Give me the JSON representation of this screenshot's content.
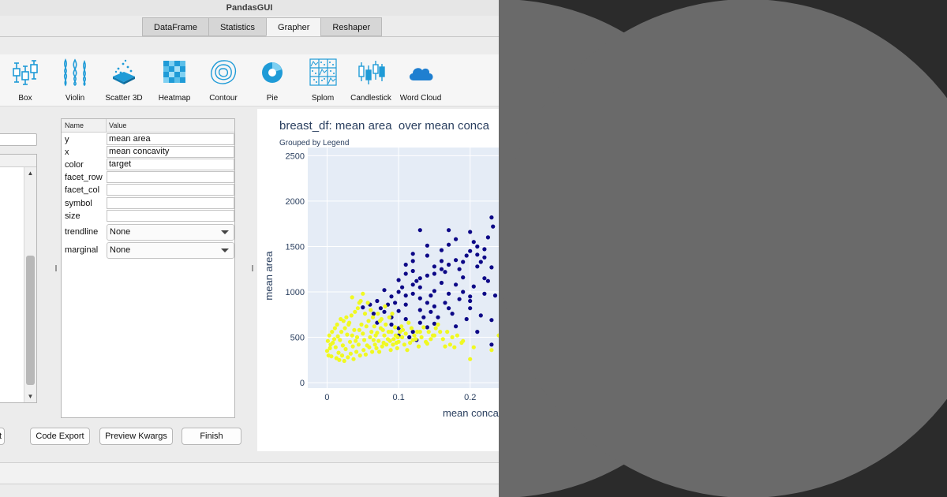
{
  "window": {
    "title": "PandasGUI"
  },
  "tabs": [
    {
      "label": "DataFrame",
      "active": false
    },
    {
      "label": "Statistics",
      "active": false
    },
    {
      "label": "Grapher",
      "active": true
    },
    {
      "label": "Reshaper",
      "active": false
    }
  ],
  "plot_types": [
    {
      "label": "Box",
      "icon": "box-plot-icon"
    },
    {
      "label": "Violin",
      "icon": "violin-plot-icon"
    },
    {
      "label": "Scatter 3D",
      "icon": "scatter-3d-icon"
    },
    {
      "label": "Heatmap",
      "icon": "heatmap-icon"
    },
    {
      "label": "Contour",
      "icon": "contour-icon"
    },
    {
      "label": "Pie",
      "icon": "pie-chart-icon"
    },
    {
      "label": "Splom",
      "icon": "splom-icon"
    },
    {
      "label": "Candlestick",
      "icon": "candlestick-icon"
    },
    {
      "label": "Word Cloud",
      "icon": "word-cloud-icon"
    }
  ],
  "kwargs": {
    "header": {
      "name": "Name",
      "value": "Value"
    },
    "fields": [
      {
        "name": "y",
        "value": "mean area"
      },
      {
        "name": "x",
        "value": "mean concavity"
      },
      {
        "name": "color",
        "value": "target"
      },
      {
        "name": "facet_row",
        "value": ""
      },
      {
        "name": "facet_col",
        "value": ""
      },
      {
        "name": "symbol",
        "value": ""
      },
      {
        "name": "size",
        "value": ""
      }
    ],
    "dropdowns": [
      {
        "name": "trendline",
        "value": "None"
      },
      {
        "name": "marginal",
        "value": "None"
      }
    ]
  },
  "buttons": {
    "reset": "t",
    "code_export": "Code Export",
    "preview_kwargs": "Preview Kwargs",
    "finish": "Finish"
  },
  "colors": {
    "accent_icon": "#1f9bd7",
    "plot_bg": "#e5ecf6",
    "series_target_0": "#0d0887",
    "series_target_1": "#f0f921"
  },
  "chart_data": {
    "type": "scatter",
    "title": "breast_df: mean area  over mean conca",
    "subtitle": "Grouped by Legend",
    "xlabel": "mean conca",
    "ylabel": "mean area",
    "xlim": [
      -0.027,
      0.24
    ],
    "ylim": [
      -60,
      2590
    ],
    "xticks": [
      "0",
      "0.1",
      "0.2"
    ],
    "yticks": [
      "0",
      "500",
      "1000",
      "1500",
      "2000",
      "2500"
    ],
    "grid": true,
    "series": [
      {
        "points": [
          [
            0.09,
            950
          ],
          [
            0.1,
            1000
          ],
          [
            0.12,
            1080
          ],
          [
            0.13,
            1150
          ],
          [
            0.15,
            1200
          ],
          [
            0.16,
            1250
          ],
          [
            0.17,
            1300
          ],
          [
            0.18,
            1350
          ],
          [
            0.2,
            1450
          ],
          [
            0.21,
            1500
          ],
          [
            0.22,
            1150
          ],
          [
            0.2,
            900
          ],
          [
            0.19,
            1000
          ],
          [
            0.14,
            880
          ],
          [
            0.11,
            1300
          ],
          [
            0.12,
            1420
          ],
          [
            0.13,
            1680
          ],
          [
            0.17,
            1680
          ],
          [
            0.2,
            1660
          ],
          [
            0.23,
            1820
          ],
          [
            0.232,
            1720
          ],
          [
            0.1,
            790
          ],
          [
            0.08,
            780
          ],
          [
            0.09,
            720
          ],
          [
            0.11,
            700
          ],
          [
            0.13,
            660
          ],
          [
            0.15,
            650
          ],
          [
            0.17,
            820
          ],
          [
            0.2,
            820
          ],
          [
            0.23,
            690
          ],
          [
            0.07,
            900
          ],
          [
            0.06,
            860
          ],
          [
            0.05,
            830
          ],
          [
            0.12,
            1230
          ],
          [
            0.14,
            1400
          ],
          [
            0.16,
            1460
          ],
          [
            0.19,
            1160
          ],
          [
            0.21,
            1280
          ],
          [
            0.22,
            1380
          ],
          [
            0.18,
            1080
          ],
          [
            0.15,
            1010
          ],
          [
            0.13,
            930
          ],
          [
            0.11,
            860
          ],
          [
            0.12,
            560
          ],
          [
            0.14,
            610
          ],
          [
            0.09,
            640
          ],
          [
            0.1,
            600
          ],
          [
            0.18,
            620
          ],
          [
            0.21,
            560
          ],
          [
            0.23,
            420
          ],
          [
            0.2,
            950
          ],
          [
            0.22,
            980
          ],
          [
            0.16,
            1100
          ],
          [
            0.14,
            1180
          ],
          [
            0.12,
            980
          ],
          [
            0.1,
            1130
          ],
          [
            0.08,
            1020
          ],
          [
            0.11,
            1200
          ],
          [
            0.13,
            1050
          ],
          [
            0.17,
            980
          ],
          [
            0.19,
            1330
          ],
          [
            0.16,
            1340
          ],
          [
            0.15,
            1280
          ],
          [
            0.21,
            1410
          ],
          [
            0.22,
            1470
          ],
          [
            0.23,
            1270
          ],
          [
            0.17,
            1520
          ],
          [
            0.18,
            1580
          ],
          [
            0.14,
            1510
          ],
          [
            0.12,
            1340
          ],
          [
            0.105,
            1050
          ],
          [
            0.125,
            1120
          ],
          [
            0.145,
            960
          ],
          [
            0.165,
            880
          ],
          [
            0.185,
            920
          ],
          [
            0.205,
            1060
          ],
          [
            0.225,
            1120
          ],
          [
            0.235,
            960
          ],
          [
            0.095,
            880
          ],
          [
            0.085,
            860
          ],
          [
            0.075,
            820
          ],
          [
            0.065,
            760
          ],
          [
            0.155,
            720
          ],
          [
            0.175,
            760
          ],
          [
            0.195,
            700
          ],
          [
            0.215,
            740
          ],
          [
            0.1,
            520
          ],
          [
            0.115,
            500
          ],
          [
            0.125,
            470
          ],
          [
            0.135,
            720
          ],
          [
            0.145,
            780
          ],
          [
            0.165,
            1220
          ],
          [
            0.185,
            1250
          ],
          [
            0.195,
            1400
          ],
          [
            0.205,
            1550
          ],
          [
            0.215,
            1330
          ],
          [
            0.225,
            1600
          ],
          [
            0.11,
            960
          ],
          [
            0.13,
            800
          ],
          [
            0.15,
            840
          ],
          [
            0.07,
            660
          ]
        ]
      },
      {
        "points": [
          [
            0.0,
            350
          ],
          [
            0.005,
            420
          ],
          [
            0.01,
            480
          ],
          [
            0.015,
            510
          ],
          [
            0.02,
            560
          ],
          [
            0.025,
            600
          ],
          [
            0.03,
            640
          ],
          [
            0.035,
            520
          ],
          [
            0.04,
            460
          ],
          [
            0.045,
            580
          ],
          [
            0.05,
            540
          ],
          [
            0.055,
            620
          ],
          [
            0.06,
            500
          ],
          [
            0.065,
            470
          ],
          [
            0.07,
            550
          ],
          [
            0.075,
            600
          ],
          [
            0.08,
            520
          ],
          [
            0.085,
            480
          ],
          [
            0.09,
            560
          ],
          [
            0.095,
            610
          ],
          [
            0.1,
            450
          ],
          [
            0.105,
            500
          ],
          [
            0.11,
            540
          ],
          [
            0.12,
            470
          ],
          [
            0.13,
            560
          ],
          [
            0.14,
            430
          ],
          [
            0.15,
            520
          ],
          [
            0.002,
            300
          ],
          [
            0.004,
            380
          ],
          [
            0.008,
            440
          ],
          [
            0.012,
            390
          ],
          [
            0.016,
            330
          ],
          [
            0.018,
            470
          ],
          [
            0.022,
            410
          ],
          [
            0.026,
            370
          ],
          [
            0.028,
            530
          ],
          [
            0.032,
            450
          ],
          [
            0.036,
            400
          ],
          [
            0.038,
            580
          ],
          [
            0.042,
            500
          ],
          [
            0.044,
            420
          ],
          [
            0.048,
            640
          ],
          [
            0.052,
            470
          ],
          [
            0.056,
            410
          ],
          [
            0.058,
            680
          ],
          [
            0.062,
            560
          ],
          [
            0.066,
            620
          ],
          [
            0.068,
            520
          ],
          [
            0.072,
            460
          ],
          [
            0.076,
            700
          ],
          [
            0.078,
            580
          ],
          [
            0.082,
            640
          ],
          [
            0.086,
            560
          ],
          [
            0.088,
            460
          ],
          [
            0.092,
            420
          ],
          [
            0.096,
            520
          ],
          [
            0.098,
            380
          ],
          [
            0.102,
            560
          ],
          [
            0.108,
            420
          ],
          [
            0.112,
            360
          ],
          [
            0.118,
            600
          ],
          [
            0.122,
            520
          ],
          [
            0.128,
            400
          ],
          [
            0.135,
            610
          ],
          [
            0.145,
            480
          ],
          [
            0.155,
            640
          ],
          [
            0.165,
            400
          ],
          [
            0.175,
            500
          ],
          [
            0.19,
            460
          ],
          [
            0.2,
            260
          ],
          [
            0.205,
            390
          ],
          [
            0.23,
            360
          ],
          [
            0.24,
            520
          ],
          [
            0.003,
            520
          ],
          [
            0.007,
            560
          ],
          [
            0.011,
            600
          ],
          [
            0.014,
            640
          ],
          [
            0.019,
            700
          ],
          [
            0.023,
            680
          ],
          [
            0.027,
            720
          ],
          [
            0.031,
            660
          ],
          [
            0.034,
            740
          ],
          [
            0.039,
            780
          ],
          [
            0.043,
            820
          ],
          [
            0.047,
            900
          ],
          [
            0.053,
            760
          ],
          [
            0.057,
            880
          ],
          [
            0.061,
            800
          ],
          [
            0.064,
            720
          ],
          [
            0.071,
            760
          ],
          [
            0.074,
            680
          ],
          [
            0.081,
            840
          ],
          [
            0.087,
            720
          ],
          [
            0.091,
            760
          ],
          [
            0.001,
            460
          ],
          [
            0.006,
            290
          ],
          [
            0.013,
            270
          ],
          [
            0.017,
            250
          ],
          [
            0.021,
            300
          ],
          [
            0.024,
            240
          ],
          [
            0.029,
            280
          ],
          [
            0.033,
            320
          ],
          [
            0.037,
            260
          ],
          [
            0.041,
            340
          ],
          [
            0.046,
            300
          ],
          [
            0.051,
            360
          ],
          [
            0.054,
            310
          ],
          [
            0.059,
            390
          ],
          [
            0.063,
            340
          ],
          [
            0.067,
            420
          ],
          [
            0.069,
            380
          ],
          [
            0.073,
            340
          ],
          [
            0.077,
            400
          ],
          [
            0.079,
            440
          ],
          [
            0.083,
            420
          ],
          [
            0.089,
            360
          ],
          [
            0.093,
            480
          ],
          [
            0.097,
            440
          ],
          [
            0.099,
            500
          ],
          [
            0.104,
            620
          ],
          [
            0.106,
            580
          ],
          [
            0.114,
            660
          ],
          [
            0.116,
            440
          ],
          [
            0.124,
            480
          ],
          [
            0.126,
            560
          ],
          [
            0.132,
            500
          ],
          [
            0.138,
            450
          ],
          [
            0.142,
            560
          ],
          [
            0.148,
            520
          ],
          [
            0.152,
            600
          ],
          [
            0.158,
            560
          ],
          [
            0.162,
            480
          ],
          [
            0.168,
            560
          ],
          [
            0.172,
            420
          ],
          [
            0.178,
            390
          ],
          [
            0.182,
            520
          ],
          [
            0.188,
            440
          ],
          [
            0.05,
            980
          ],
          [
            0.045,
            880
          ],
          [
            0.035,
            940
          ]
        ]
      }
    ]
  }
}
